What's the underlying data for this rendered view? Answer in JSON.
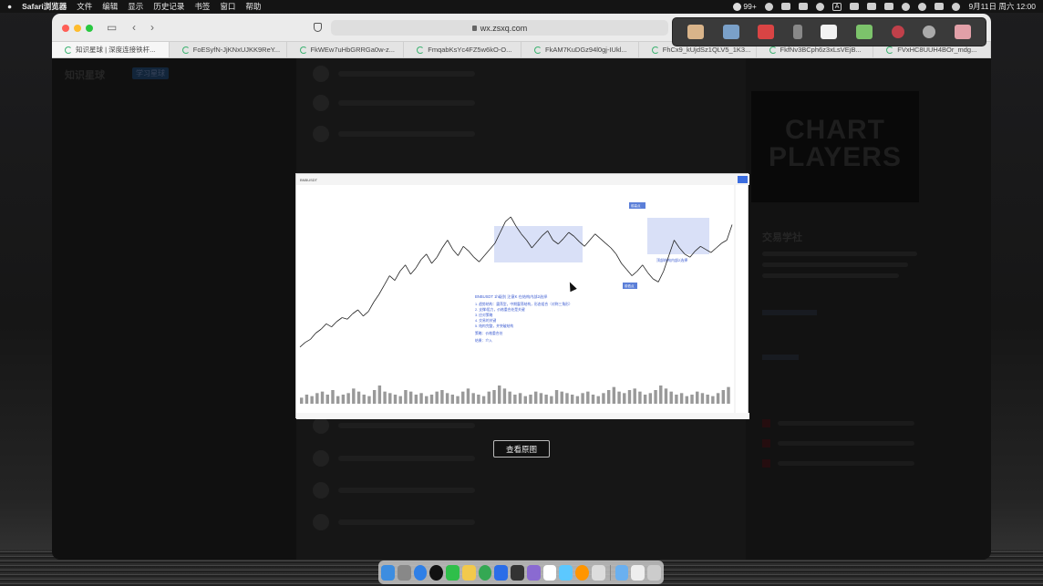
{
  "menubar": {
    "apple": "",
    "app_name": "Safari浏览器",
    "items": [
      "文件",
      "编辑",
      "显示",
      "历史记录",
      "书签",
      "窗口",
      "帮助"
    ],
    "badge": "99+",
    "ime": "A",
    "datetime": "9月11日 周六 12:00"
  },
  "browser": {
    "url": "wx.zsxq.com",
    "tabs": [
      {
        "label": "知识星球 | 深度连接铁杆..."
      },
      {
        "label": "FoESyfN-JjKNxUJKK9ReY..."
      },
      {
        "label": "FkWEw7uHbGRRGa0w-z..."
      },
      {
        "label": "FmqabKsYc4FZ5w6kO-O..."
      },
      {
        "label": "FkAM7KuDGz94l0gj-IUkl..."
      },
      {
        "label": "FhCx9_kUjdSz1QLV5_1K3..."
      },
      {
        "label": "FkfNv3BCph6z3xLsVEjB..."
      },
      {
        "label": "FVxHC8UUH4BOr_mdg..."
      }
    ]
  },
  "site": {
    "title": "知识星球",
    "tag": "学习星球",
    "club_banner_line1": "CHART",
    "club_banner_line2": "PLAYERS",
    "club_name": "交易学社"
  },
  "lightbox": {
    "view_original_label": "查看原图"
  },
  "chart": {
    "symbol": "BNBUSDT",
    "annotation_title": "BNBUSDT 1h级别 注意K 在结构内部2选择",
    "annotation_lines": [
      "1. 趋势结构：震荡型，中期震荡结构，形态组合（对称三角形）",
      "2. 支撑/阻力，价格重合处是关键",
      "3. 应对策略",
      "4. 交易的关键",
      "5. 结构完整，并突破结构"
    ],
    "note1": "策略：价格重合处",
    "note2": "结果：介入",
    "box_label": "顶部结构内部2选择",
    "marker_top": "前高点",
    "marker_bottom": "前低点"
  },
  "chart_data": {
    "type": "line",
    "title": "",
    "series": [
      {
        "values": [
          12,
          18,
          22,
          30,
          35,
          42,
          38,
          45,
          50,
          48,
          55,
          60,
          52,
          58,
          70,
          80,
          92,
          104,
          98,
          110,
          118,
          106,
          114,
          125,
          132,
          120,
          128,
          140,
          150,
          138,
          130,
          142,
          136,
          128,
          122,
          130,
          138,
          146,
          160,
          174,
          180,
          168,
          158,
          150,
          140,
          148,
          156,
          162,
          150,
          145,
          152,
          160,
          155,
          148,
          142,
          150,
          158,
          152,
          146,
          140,
          132,
          120,
          112,
          104,
          110,
          118,
          108,
          100,
          96,
          110,
          130,
          150,
          140,
          132,
          128,
          136,
          142,
          138,
          134,
          140,
          146,
          150,
          170
        ]
      }
    ],
    "volume": [
      4,
      6,
      5,
      7,
      8,
      6,
      9,
      5,
      6,
      7,
      10,
      8,
      6,
      5,
      9,
      12,
      8,
      7,
      6,
      5,
      9,
      8,
      6,
      7,
      5,
      6,
      8,
      9,
      7,
      6,
      5,
      8,
      10,
      7,
      6,
      5,
      8,
      9,
      12,
      10,
      8,
      6,
      7,
      5,
      6,
      8,
      7,
      6,
      5,
      9,
      8,
      7,
      6,
      5,
      7,
      8,
      6,
      5,
      7,
      9,
      11,
      8,
      7,
      9,
      10,
      8,
      6,
      7,
      9,
      12,
      10,
      8,
      6,
      7,
      5,
      6,
      8,
      7,
      6,
      5,
      7,
      9,
      11
    ],
    "ylim": [
      0,
      200
    ]
  }
}
